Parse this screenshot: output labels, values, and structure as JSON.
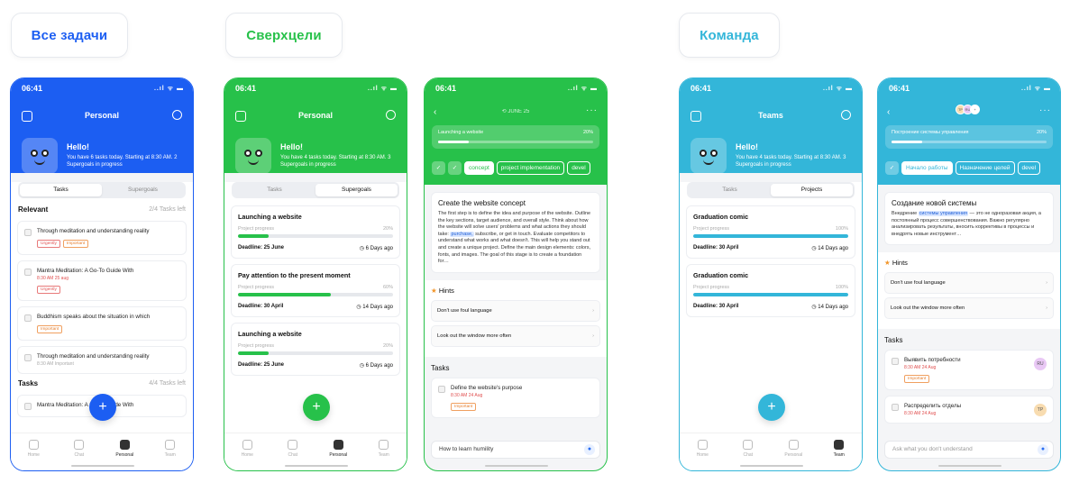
{
  "colors": {
    "blue": "#1c5ef2",
    "green": "#27c14a",
    "cyan": "#33b6d9"
  },
  "labels": {
    "all": "Все задачи",
    "super": "Сверхцели",
    "team": "Команда"
  },
  "status": {
    "time": "06:41",
    "signal": "..ıl ᯤ ▬"
  },
  "nav": [
    "Home",
    "Chat",
    "Personal",
    "Team"
  ],
  "nav_team": [
    "Home",
    "Chat",
    "Personal",
    "Team"
  ],
  "common": {
    "hello": "Hello!",
    "personal": "Personal",
    "teams": "Teams",
    "tasks": "Tasks",
    "supergoals": "Supergoals",
    "projects": "Projects",
    "fab": "+",
    "chev": "›",
    "hints": "Hints",
    "star": "★",
    "deadline_label": "Deadline:"
  },
  "s1": {
    "sub": "You have 6 tasks today. Starting at 8:30 AM. 2 Supergoals in progress",
    "relevant": "Relevant",
    "relevant_left": "2/4 Tasks left",
    "tasks_left": "4/4 Tasks left",
    "items": [
      {
        "text": "Through meditation and understanding reality",
        "meta": "",
        "tags": [
          "Urgently",
          "Important"
        ]
      },
      {
        "text": "Mantra Meditation: A Go-To Guide With",
        "meta": "8:30 AM   25 aug",
        "tags": [
          "Urgently"
        ]
      },
      {
        "text": "Buddhism speaks about the situation in which",
        "meta": "",
        "tags": [
          "Important"
        ]
      },
      {
        "text": "Through meditation and understanding reality",
        "meta": "8:30 AM   Important",
        "tags": []
      }
    ],
    "last": "Mantra Meditation: A Go-To Guide With"
  },
  "s2": {
    "sub": "You have 4 tasks today. Starting at 8:30 AM. 3 Supergoals in progress",
    "cards": [
      {
        "title": "Launching a website",
        "lab": "Project progress",
        "pct": "20%",
        "val": 0.2,
        "deadline": "Deadline: 25 June",
        "days": "◷ 6 Days ago"
      },
      {
        "title": "Pay attention to the present moment",
        "lab": "Project progress",
        "pct": "60%",
        "val": 0.6,
        "deadline": "Deadline: 30 April",
        "days": "◷ 14 Days ago"
      },
      {
        "title": "Launching a website",
        "lab": "Project progress",
        "pct": "20%",
        "val": 0.2,
        "deadline": "Deadline: 25 June",
        "days": "◷ 6 Days ago"
      }
    ]
  },
  "s3": {
    "date": "⟲ JUNE 25",
    "prog_title": "Launching a website",
    "prog_pct": "20%",
    "chips": [
      "concept",
      "project implementation",
      "devel"
    ],
    "card_title": "Create the website concept",
    "card_text_a": "The first step is to define the idea and purpose of the website. Outline the key sections, target audience, and overall style. Think about how the website will solve users' problems and what actions they should take: ",
    "card_hl": "purchase,",
    "card_text_b": " subscribe, or get in touch. Evaluate competitors to understand what works and what doesn't. This will help you stand out and create a unique project. Define the main design elements: colors, fonts, and images. The goal of this stage is to create a foundation for…",
    "hints": [
      "Don't use foul language",
      "Look out the window more often"
    ],
    "task": "Define the website's purpose",
    "task_meta": "8:30 AM   24 Aug",
    "task_tag": "Important",
    "ask": "How to learn humility"
  },
  "s4": {
    "sub": "You have 4 tasks today. Starting at 8:30 AM. 3 Supergoals in progress",
    "cards": [
      {
        "title": "Graduation comic",
        "lab": "Project progress",
        "pct": "100%",
        "val": 1,
        "deadline": "Deadline: 30 April",
        "days": "◷ 14 Days ago"
      },
      {
        "title": "Graduation comic",
        "lab": "Project progress",
        "pct": "100%",
        "val": 1,
        "deadline": "Deadline: 30 April",
        "days": "◷ 14 Days ago"
      }
    ]
  },
  "s5": {
    "avatars": [
      "TP",
      "RU",
      "+"
    ],
    "prog_title": "Построение системы управления",
    "prog_pct": "20%",
    "chips": [
      "Начало работы",
      "Назначение целей",
      "devel"
    ],
    "card_title": "Создание новой системы",
    "card_text_a": "Внедрение ",
    "card_hl": "системы управления",
    "card_text_b": " — это не одноразовая акция, а постоянный процесс совершенствования. Важно регулярно анализировать результаты, вносить коррективы в процессы и внедрять новые инструмент…",
    "hints": [
      "Don't use foul language",
      "Look out the window more often"
    ],
    "tasks": [
      {
        "text": "Выявить потребности",
        "meta": "8:30 AM   24 Aug",
        "tag": "Important",
        "av": "RU",
        "avc": "#e9c8f5"
      },
      {
        "text": "Распределить отделы",
        "meta": "8:30 AM   24 Aug",
        "tag": "",
        "av": "TP",
        "avc": "#f8dcb0"
      }
    ],
    "ask": "Ask what you don't understand"
  }
}
